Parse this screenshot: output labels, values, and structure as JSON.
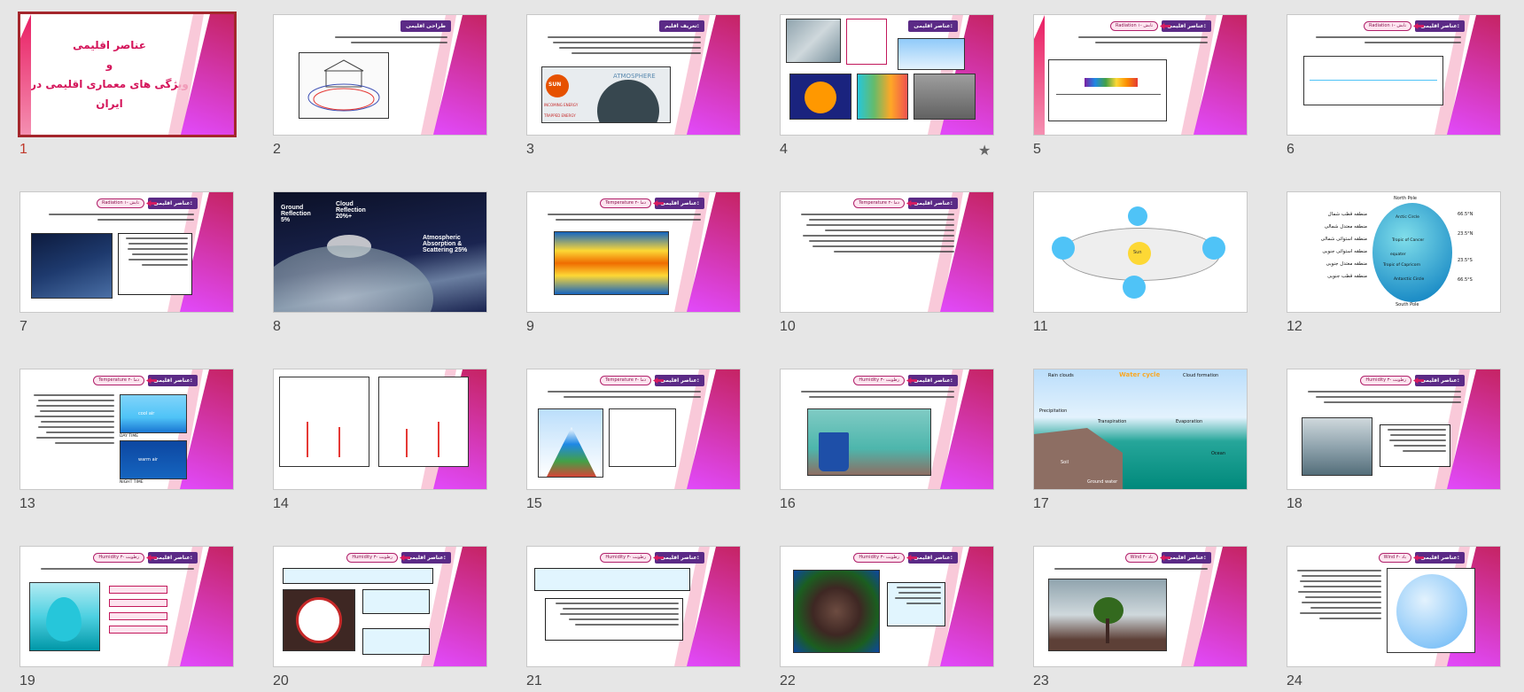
{
  "slides": [
    {
      "n": "1",
      "selected": true,
      "title_lines": [
        "عناصر اقلیمی",
        "و",
        "ویژگی های معماری اقلیمی در ایران"
      ]
    },
    {
      "n": "2",
      "badge": "طراحی اقلیمی"
    },
    {
      "n": "3",
      "badge": "تعریف اقلیم:",
      "labels": [
        "SUN",
        "ATMOSPHERE",
        "INCOMING ENERGY",
        "TRAPPED ENERGY"
      ]
    },
    {
      "n": "4",
      "badge": "عناصر اقلیمی:",
      "has_star": true,
      "star": "★"
    },
    {
      "n": "5",
      "badge": "عناصر اقلیمی:",
      "pill": "Radiation ۱- تابش"
    },
    {
      "n": "6",
      "badge": "عناصر اقلیمی:",
      "pill": "Radiation ۱- تابش"
    },
    {
      "n": "7",
      "badge": "عناصر اقلیمی:",
      "pill": "Radiation ۱- تابش"
    },
    {
      "n": "8",
      "labels": [
        "Ground Reflection 5%",
        "Cloud Reflection 20%+",
        "Atmospheric Absorption & Scattering 25%"
      ]
    },
    {
      "n": "9",
      "badge": "عناصر اقلیمی:",
      "pill": "Temperature ۲- دما"
    },
    {
      "n": "10",
      "badge": "عناصر اقلیمی:",
      "pill": "Temperature ۲- دما"
    },
    {
      "n": "11",
      "labels": [
        "Sun"
      ]
    },
    {
      "n": "12",
      "labels": [
        "North Pole",
        "Arctic Circle",
        "66.5°N",
        "Tropic of Cancer",
        "23.5°N",
        "equater",
        "Tropic of Capricorn",
        "23.5°S",
        "Antarctic Circle",
        "66.5°S",
        "South Pole",
        "منطقه قطب شمال",
        "منطقه معتدل شمالی",
        "منطقه استوائی شمالی",
        "منطقه استوائی جنوبی",
        "منطقه معتدل جنوبی",
        "منطقه قطب جنوبی"
      ]
    },
    {
      "n": "13",
      "badge": "عناصر اقلیمی:",
      "pill": "Temperature ۲- دما",
      "labels": [
        "DAY TIME",
        "NIGHT TIME",
        "cool air",
        "warm air"
      ]
    },
    {
      "n": "14"
    },
    {
      "n": "15",
      "badge": "عناصر اقلیمی:",
      "pill": "Temperature ۲- دما"
    },
    {
      "n": "16",
      "badge": "عناصر اقلیمی:",
      "pill": "Humidity ۳- رطوبت"
    },
    {
      "n": "17",
      "labels": [
        "Water cycle",
        "Rain clouds",
        "Cloud formation",
        "Precipitation",
        "Transpiration",
        "Evaporation",
        "Ocean",
        "Soil",
        "Ground water"
      ]
    },
    {
      "n": "18",
      "badge": "عناصر اقلیمی:",
      "pill": "Humidity ۳- رطوبت"
    },
    {
      "n": "19",
      "badge": "عناصر اقلیمی:",
      "pill": "Humidity ۳- رطوبت"
    },
    {
      "n": "20",
      "badge": "عناصر اقلیمی:",
      "pill": "Humidity ۳- رطوبت"
    },
    {
      "n": "21",
      "badge": "عناصر اقلیمی:",
      "pill": "Humidity ۳- رطوبت"
    },
    {
      "n": "22",
      "badge": "عناصر اقلیمی:",
      "pill": "Humidity ۳- رطوبت"
    },
    {
      "n": "23",
      "badge": "عناصر اقلیمی:",
      "pill": "Wind ۴- باد"
    },
    {
      "n": "24",
      "badge": "عناصر اقلیمی:",
      "pill": "Wind ۴- باد"
    }
  ]
}
